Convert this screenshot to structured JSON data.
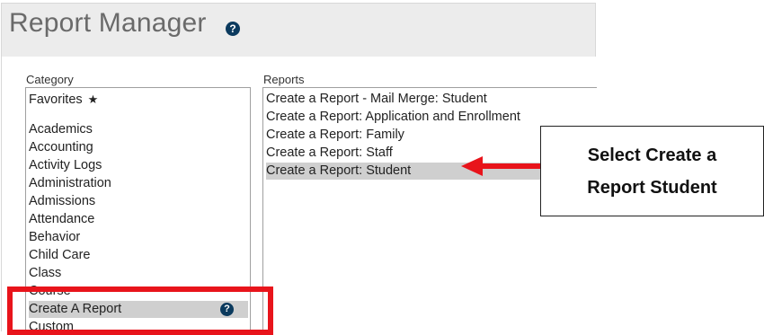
{
  "header": {
    "title": "Report Manager",
    "help_icon": "?"
  },
  "category": {
    "label": "Category",
    "items": [
      {
        "label": "Favorites",
        "icon": "star-icon",
        "star": "★"
      },
      {
        "label": ""
      },
      {
        "label": "Academics"
      },
      {
        "label": "Accounting"
      },
      {
        "label": "Activity Logs"
      },
      {
        "label": "Administration"
      },
      {
        "label": "Admissions"
      },
      {
        "label": "Attendance"
      },
      {
        "label": "Behavior"
      },
      {
        "label": "Child Care"
      },
      {
        "label": "Class"
      },
      {
        "label": "Course"
      },
      {
        "label": "Create A Report",
        "selected": true,
        "help": "?"
      },
      {
        "label": "Custom"
      }
    ]
  },
  "reports": {
    "label": "Reports",
    "items": [
      {
        "label": "Create a Report - Mail Merge: Student"
      },
      {
        "label": "Create a Report: Application and Enrollment"
      },
      {
        "label": "Create a Report: Family"
      },
      {
        "label": "Create a Report: Staff"
      },
      {
        "label": "Create a Report: Student",
        "selected": true
      }
    ]
  },
  "annotation": {
    "callout_line1": "Select Create a",
    "callout_line2": "Report Student",
    "highlight_color": "#e8141b"
  }
}
